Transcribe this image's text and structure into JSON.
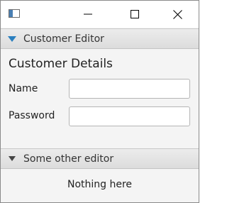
{
  "window": {
    "icon": "app-window-icon",
    "controls": {
      "minimize_icon": "minimize-icon",
      "maximize_icon": "maximize-icon",
      "close_icon": "close-icon"
    }
  },
  "panes": [
    {
      "title": "Customer Editor",
      "expanded": true,
      "arrow_color": "#2a7fbf",
      "content": {
        "heading": "Customer Details",
        "fields": [
          {
            "label": "Name",
            "value": "",
            "placeholder": ""
          },
          {
            "label": "Password",
            "value": "",
            "placeholder": ""
          }
        ]
      }
    },
    {
      "title": "Some other editor",
      "expanded": true,
      "arrow_color": "#444444",
      "content": {
        "text": "Nothing here"
      }
    }
  ]
}
